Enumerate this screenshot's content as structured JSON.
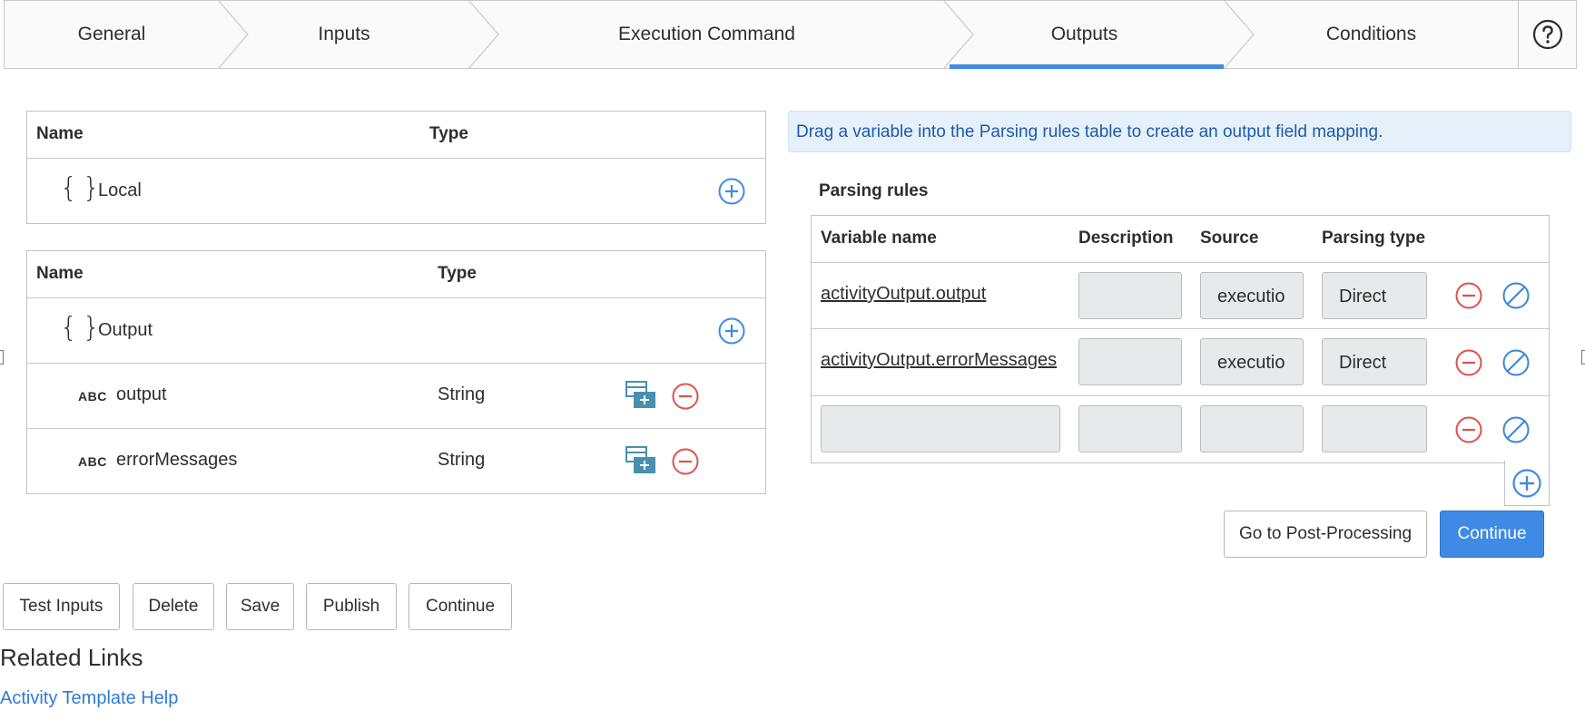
{
  "wizard": {
    "steps": [
      {
        "label": "General"
      },
      {
        "label": "Inputs"
      },
      {
        "label": "Execution Command"
      },
      {
        "label": "Outputs"
      },
      {
        "label": "Conditions"
      }
    ],
    "active_step": "Outputs",
    "help_icon": "question-circle-icon"
  },
  "local_table": {
    "headers": {
      "name": "Name",
      "type": "Type"
    },
    "group": {
      "label": "Local",
      "icon": "braces-icon"
    }
  },
  "output_table": {
    "headers": {
      "name": "Name",
      "type": "Type"
    },
    "group": {
      "label": "Output",
      "icon": "braces-icon"
    },
    "items": [
      {
        "badge": "ABC",
        "name": "output",
        "type": "String"
      },
      {
        "badge": "ABC",
        "name": "errorMessages",
        "type": "String"
      }
    ]
  },
  "info_message": "Drag a variable into the Parsing rules table to create an output field mapping.",
  "parsing": {
    "title": "Parsing rules",
    "headers": {
      "variable": "Variable name",
      "description": "Description",
      "source": "Source",
      "parsing_type": "Parsing type"
    },
    "rows": [
      {
        "variable": "activityOutput.output",
        "description": "",
        "source": "executio",
        "parsing_type": "Direct"
      },
      {
        "variable": "activityOutput.errorMessages",
        "description": "",
        "source": "executio",
        "parsing_type": "Direct"
      },
      {
        "variable": "",
        "description": "",
        "source": "",
        "parsing_type": ""
      }
    ]
  },
  "actions": {
    "post_processing": "Go to Post-Processing",
    "continue": "Continue"
  },
  "footer_buttons": {
    "test_inputs": "Test Inputs",
    "delete": "Delete",
    "save": "Save",
    "publish": "Publish",
    "continue": "Continue"
  },
  "related": {
    "heading": "Related Links",
    "link": "Activity Template Help"
  },
  "colors": {
    "accent": "#3f8ae5",
    "add_icon": "#3f8ae5",
    "remove_icon": "#e0504d",
    "block_icon": "#3a86d8",
    "map_icon": "#4a8fb0"
  }
}
